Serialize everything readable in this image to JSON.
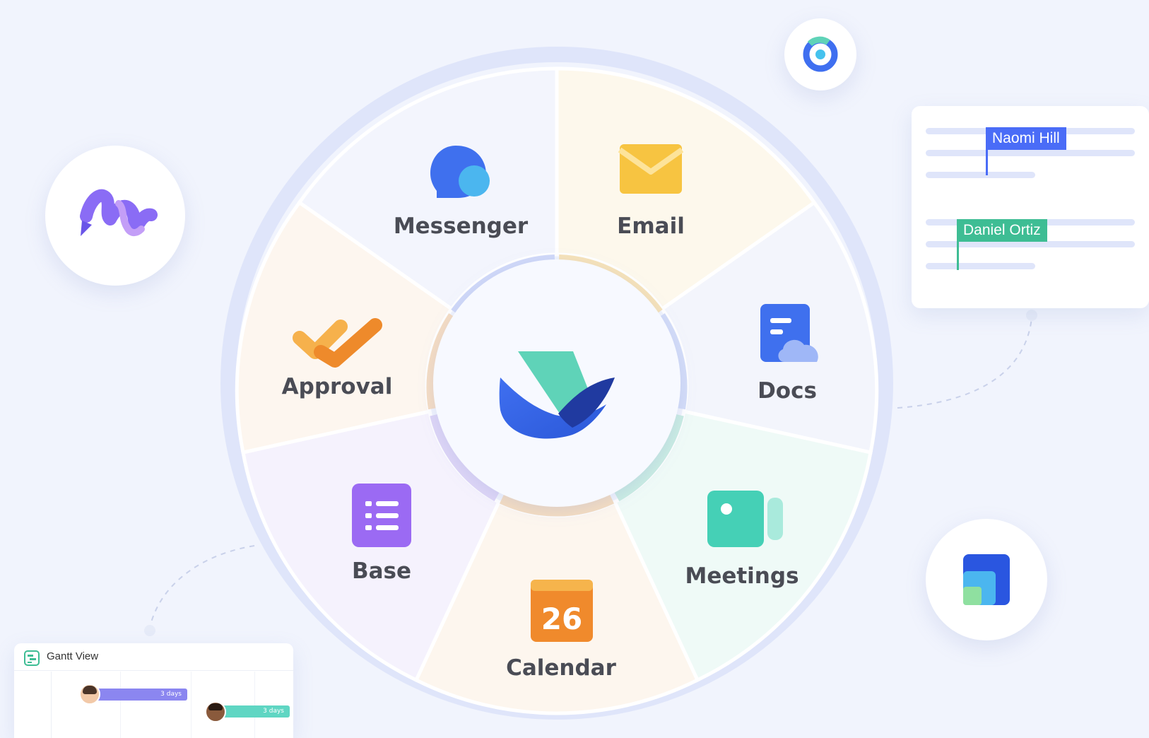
{
  "segments": {
    "messenger": "Messenger",
    "email": "Email",
    "docs": "Docs",
    "meetings": "Meetings",
    "calendar": "Calendar",
    "base": "Base",
    "approval": "Approval"
  },
  "calendar_day": "26",
  "assignment_card": {
    "tags": [
      "Naomi Hill",
      "Daniel Ortiz"
    ],
    "colors": {
      "naomi": "#4a6cf7",
      "daniel": "#3ebd94"
    }
  },
  "gantt_card": {
    "title": "Gantt View",
    "bars": [
      {
        "label": "3 days",
        "color": "#8b86f0"
      },
      {
        "label": "3 days",
        "color": "#5fd6c3"
      }
    ]
  },
  "icons": {
    "center": "lark-bird-logo",
    "messenger": "chat-bubbles-icon",
    "email": "envelope-icon",
    "docs": "document-cloud-icon",
    "meetings": "video-camera-icon",
    "calendar": "calendar-icon",
    "base": "table-list-icon",
    "approval": "check-marks-icon",
    "floating": [
      "pen-wave-app-icon",
      "ring-app-icon",
      "layers-app-icon"
    ]
  },
  "colors": {
    "background": "#f1f4fd",
    "ring": "#dfe5fa",
    "label": "#4a4c55"
  }
}
